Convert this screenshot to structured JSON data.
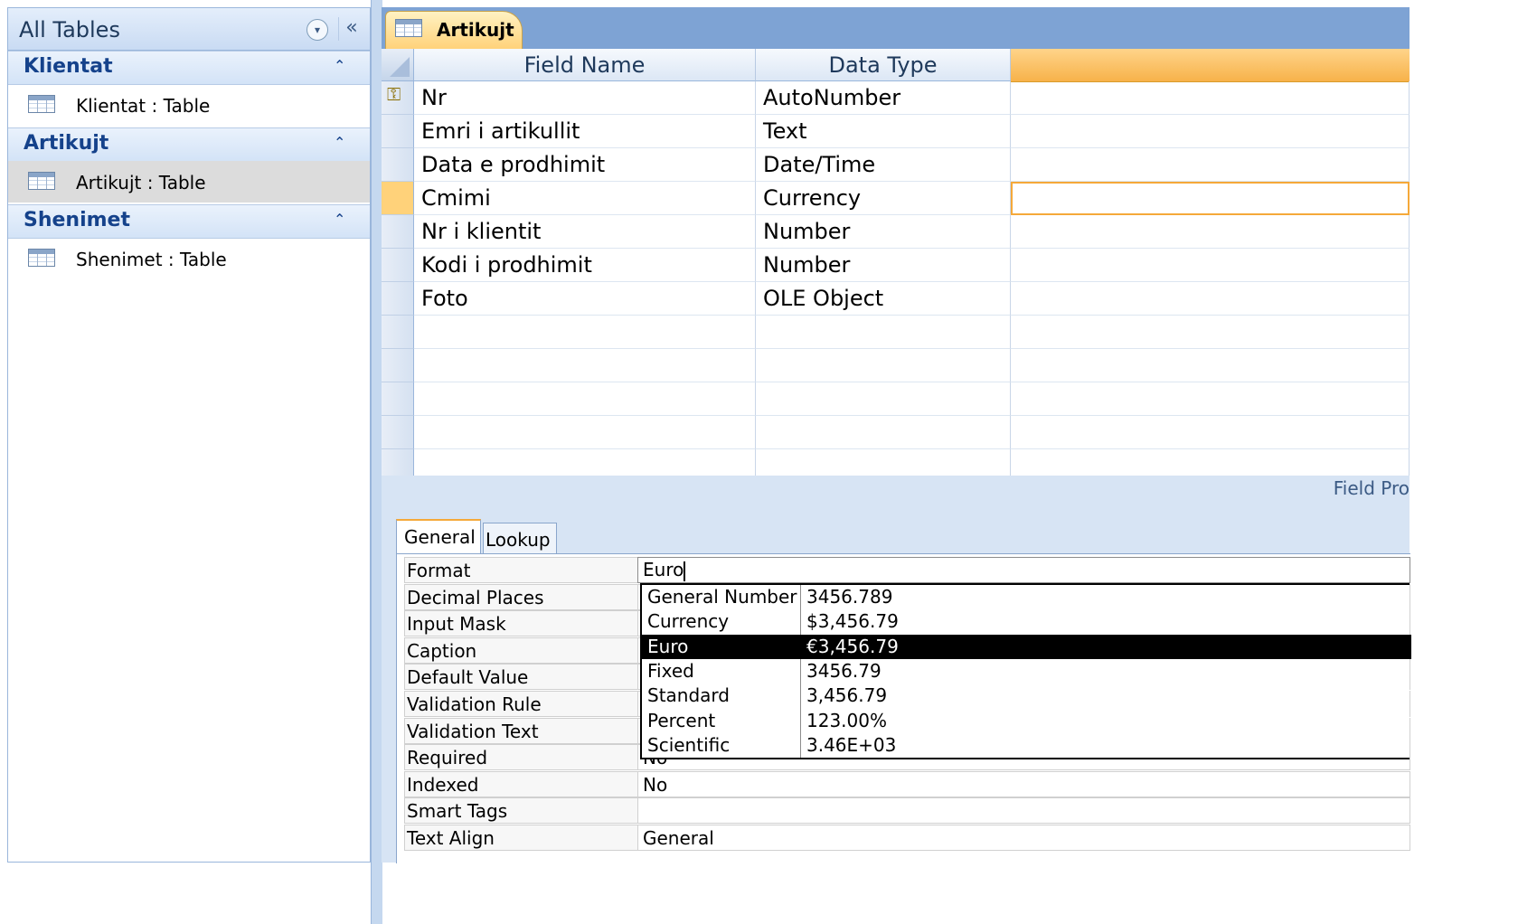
{
  "nav": {
    "title": "All Tables",
    "groups": [
      {
        "name": "Klientat",
        "item": "Klientat : Table"
      },
      {
        "name": "Artikujt",
        "item": "Artikujt : Table"
      },
      {
        "name": "Shenimet",
        "item": "Shenimet : Table"
      }
    ]
  },
  "document_tab": {
    "label": "Artikujt"
  },
  "grid": {
    "columns": [
      "Field Name",
      "Data Type"
    ],
    "rows": [
      {
        "field": "Nr",
        "type": "AutoNumber"
      },
      {
        "field": "Emri i artikullit",
        "type": "Text"
      },
      {
        "field": "Data e prodhimit",
        "type": "Date/Time"
      },
      {
        "field": "Cmimi",
        "type": "Currency"
      },
      {
        "field": "Nr i klientit",
        "type": "Number"
      },
      {
        "field": "Kodi i prodhimit",
        "type": "Number"
      },
      {
        "field": "Foto",
        "type": "OLE Object"
      }
    ]
  },
  "properties": {
    "title": "Field Pro",
    "tabs": [
      "General",
      "Lookup"
    ],
    "rows": [
      {
        "label": "Format",
        "value": "Euro"
      },
      {
        "label": "Decimal Places",
        "value": ""
      },
      {
        "label": "Input Mask",
        "value": ""
      },
      {
        "label": "Caption",
        "value": ""
      },
      {
        "label": "Default Value",
        "value": ""
      },
      {
        "label": "Validation Rule",
        "value": ""
      },
      {
        "label": "Validation Text",
        "value": ""
      },
      {
        "label": "Required",
        "value": "No"
      },
      {
        "label": "Indexed",
        "value": "No"
      },
      {
        "label": "Smart Tags",
        "value": ""
      },
      {
        "label": "Text Align",
        "value": "General"
      }
    ]
  },
  "format_dropdown": {
    "options": [
      {
        "name": "General Number",
        "sample": "3456.789"
      },
      {
        "name": "Currency",
        "sample": "$3,456.79"
      },
      {
        "name": "Euro",
        "sample": "€3,456.79"
      },
      {
        "name": "Fixed",
        "sample": "3456.79"
      },
      {
        "name": "Standard",
        "sample": "3,456.79"
      },
      {
        "name": "Percent",
        "sample": "123.00%"
      },
      {
        "name": "Scientific",
        "sample": "3.46E+03"
      }
    ]
  }
}
